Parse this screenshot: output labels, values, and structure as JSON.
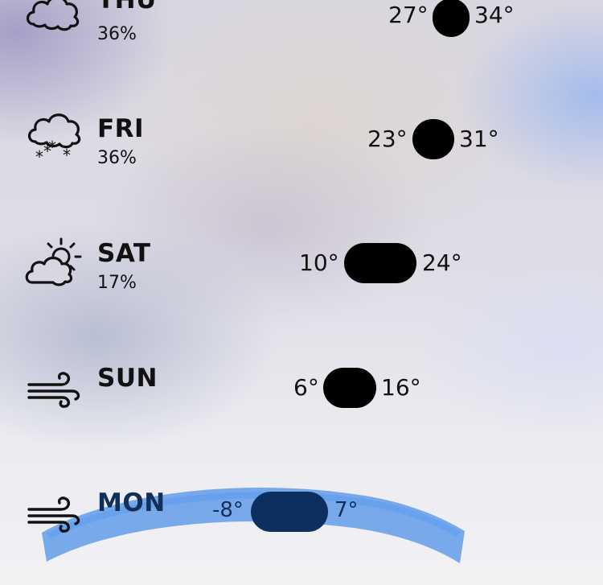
{
  "forecast": [
    {
      "day": "THU",
      "precip": "36%",
      "low": "27°",
      "high": "34°",
      "icon": "cloud-icon"
    },
    {
      "day": "FRI",
      "precip": "36%",
      "low": "23°",
      "high": "31°",
      "icon": "snow-cloud-icon"
    },
    {
      "day": "SAT",
      "precip": "17%",
      "low": "10°",
      "high": "24°",
      "icon": "partly-cloudy-icon"
    },
    {
      "day": "SUN",
      "precip": "",
      "low": "6°",
      "high": "16°",
      "icon": "wind-icon"
    },
    {
      "day": "MON",
      "precip": "",
      "low": "-8°",
      "high": "7°",
      "icon": "wind-icon"
    }
  ],
  "colors": {
    "text": "#111111",
    "bar": "#000000",
    "highlight": "#4a8ee6"
  }
}
